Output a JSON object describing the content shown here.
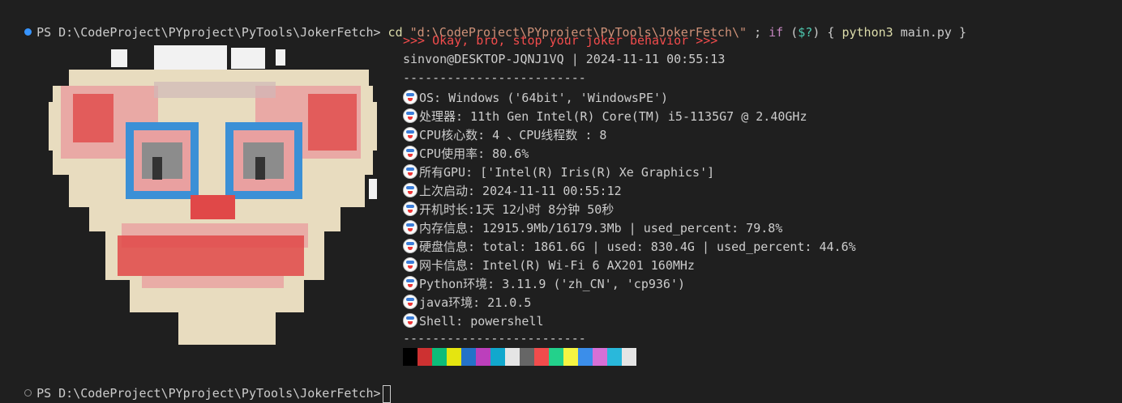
{
  "terminal": {
    "prompt": "PS D:\\CodeProject\\PYproject\\PyTools\\JokerFetch>",
    "command_cd": "cd",
    "command_path": "\"d:\\CodeProject\\PYproject\\PyTools\\JokerFetch\\\"",
    "command_sep": " ; ",
    "command_if": "if",
    "command_cond_open": " (",
    "command_cond_var": "$?",
    "command_cond_close": ") { ",
    "command_python": "python3",
    "command_rest": " main.py }",
    "final_prompt": "PS D:\\CodeProject\\PYproject\\PyTools\\JokerFetch>"
  },
  "fetch": {
    "banner": ">>> Okay, bro, stop your joker behavior >>>",
    "user_line": "sinvon@DESKTOP-JQNJ1VQ | 2024-11-11 00:55:13",
    "separator": "-------------------------",
    "rows": [
      "OS: Windows ('64bit', 'WindowsPE')",
      "处理器: 11th Gen Intel(R) Core(TM) i5-1135G7 @ 2.40GHz",
      "CPU核心数: 4 、CPU线程数 : 8",
      "CPU使用率: 80.6%",
      "所有GPU: ['Intel(R) Iris(R) Xe Graphics']",
      "上次启动: 2024-11-11 00:55:12",
      "开机时长:1天 12小时 8分钟 50秒",
      "内存信息: 12915.9Mb/16179.3Mb | used_percent: 79.8%",
      "硬盘信息: total: 1861.6G | used: 830.4G | used_percent: 44.6%",
      "网卡信息: Intel(R) Wi-Fi 6 AX201 160MHz",
      "Python环境: 3.11.9 ('zh_CN', 'cp936')",
      "java环境: 21.0.5",
      "Shell: powershell"
    ],
    "row_icon": "clown-face-icon",
    "separator_bottom": "-------------------------"
  },
  "palette": [
    "#000000",
    "#cd3131",
    "#0dbc79",
    "#e5e510",
    "#2472c8",
    "#bc3fbc",
    "#11a8cd",
    "#e5e5e5",
    "#666666",
    "#f14c4c",
    "#23d18b",
    "#f5f543",
    "#3b8eea",
    "#d670d6",
    "#29b8db",
    "#e5e5e5"
  ],
  "art_colors": {
    "cream": "#e8dcbf",
    "white": "#f2f2f2",
    "red": "#e04848",
    "pink": "#e9a0a0",
    "blue": "#3b90d6",
    "gray": "#8c8c8c",
    "dark": "#333333",
    "shade": "#d0b8b8"
  }
}
